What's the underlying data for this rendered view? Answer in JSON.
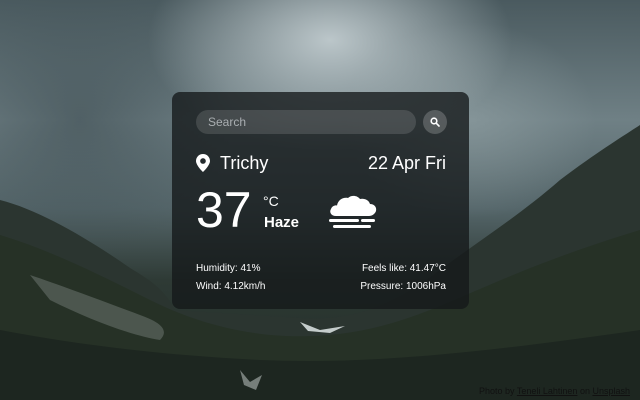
{
  "search": {
    "placeholder": "Search"
  },
  "weather": {
    "city": "Trichy",
    "date": "22 Apr Fri",
    "temperature": "37",
    "unit": "°C",
    "condition": "Haze",
    "condition_icon": "haze-cloud-icon"
  },
  "details": {
    "humidity": "Humidity: 41%",
    "wind": "Wind: 4.12km/h",
    "feels_like": "Feels like: 41.47°C",
    "pressure": "Pressure: 1006hPa"
  },
  "credit": {
    "prefix": "Photo by ",
    "author": "Teneli Lahtinen",
    "middle": " on ",
    "site": "Unsplash"
  },
  "colors": {
    "card_bg": "#14181a",
    "text": "#ffffff"
  }
}
